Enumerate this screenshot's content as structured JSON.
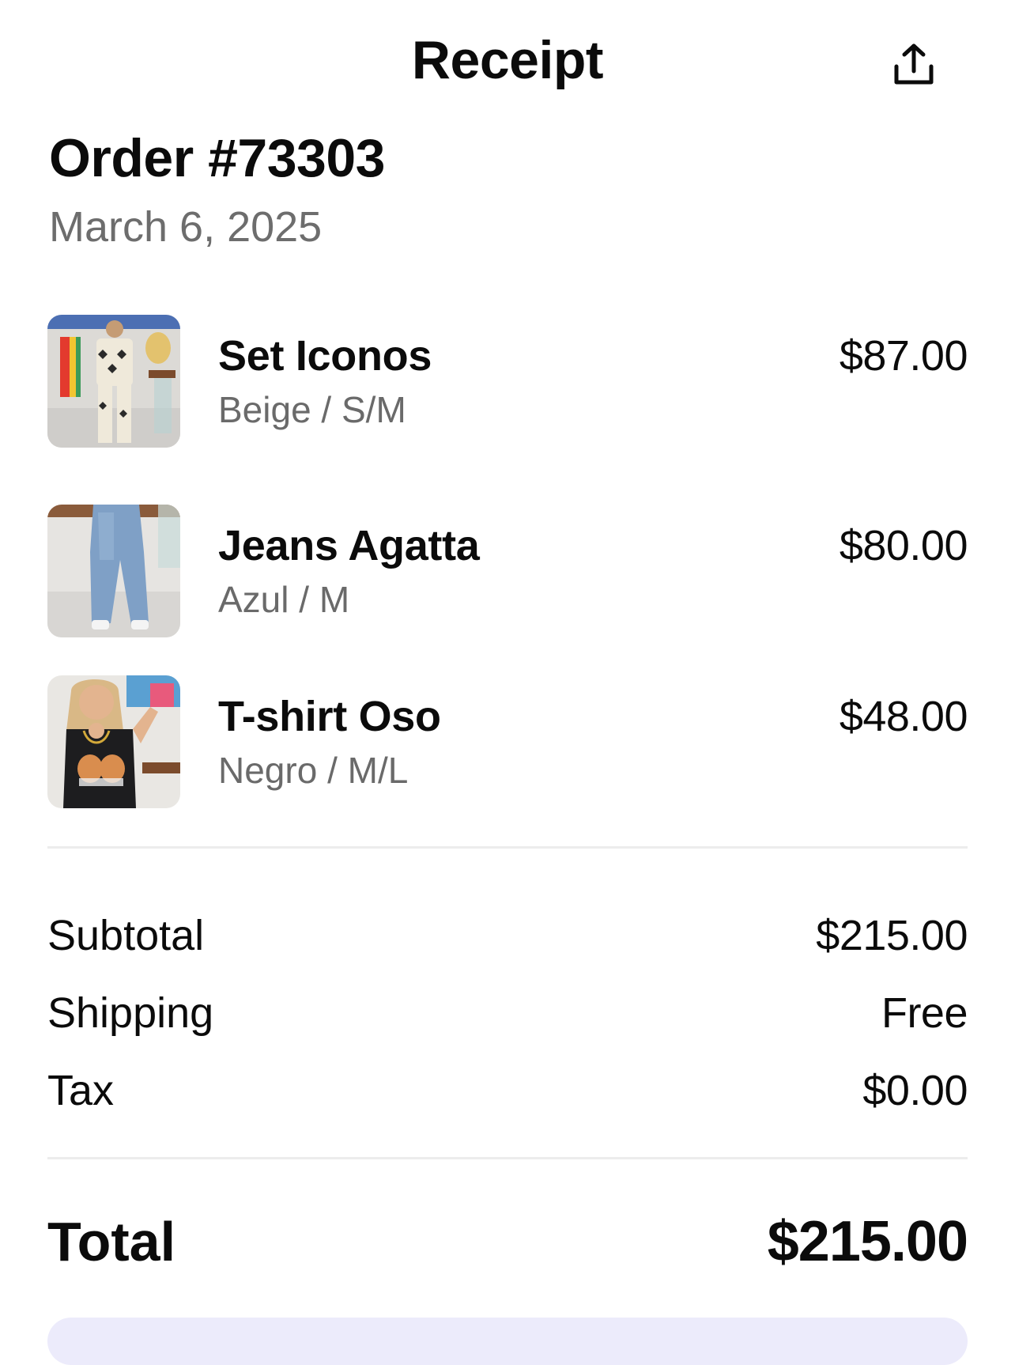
{
  "header": {
    "title": "Receipt",
    "share_icon": "share-icon"
  },
  "order": {
    "number": "Order #73303",
    "date": "March 6, 2025"
  },
  "items": [
    {
      "name": "Set Iconos",
      "variant": "Beige / S/M",
      "price": "$87.00"
    },
    {
      "name": "Jeans Agatta",
      "variant": "Azul / M",
      "price": "$80.00"
    },
    {
      "name": "T-shirt Oso",
      "variant": "Negro / M/L",
      "price": "$48.00"
    }
  ],
  "summary": {
    "subtotal_label": "Subtotal",
    "subtotal_value": "$215.00",
    "shipping_label": "Shipping",
    "shipping_value": "Free",
    "tax_label": "Tax",
    "tax_value": "$0.00",
    "total_label": "Total",
    "total_value": "$215.00"
  },
  "colors": {
    "text": "#0b0b0b",
    "secondary_text": "#6d6d6d",
    "divider": "#ececec",
    "bottom_card": "#ecebfb"
  }
}
